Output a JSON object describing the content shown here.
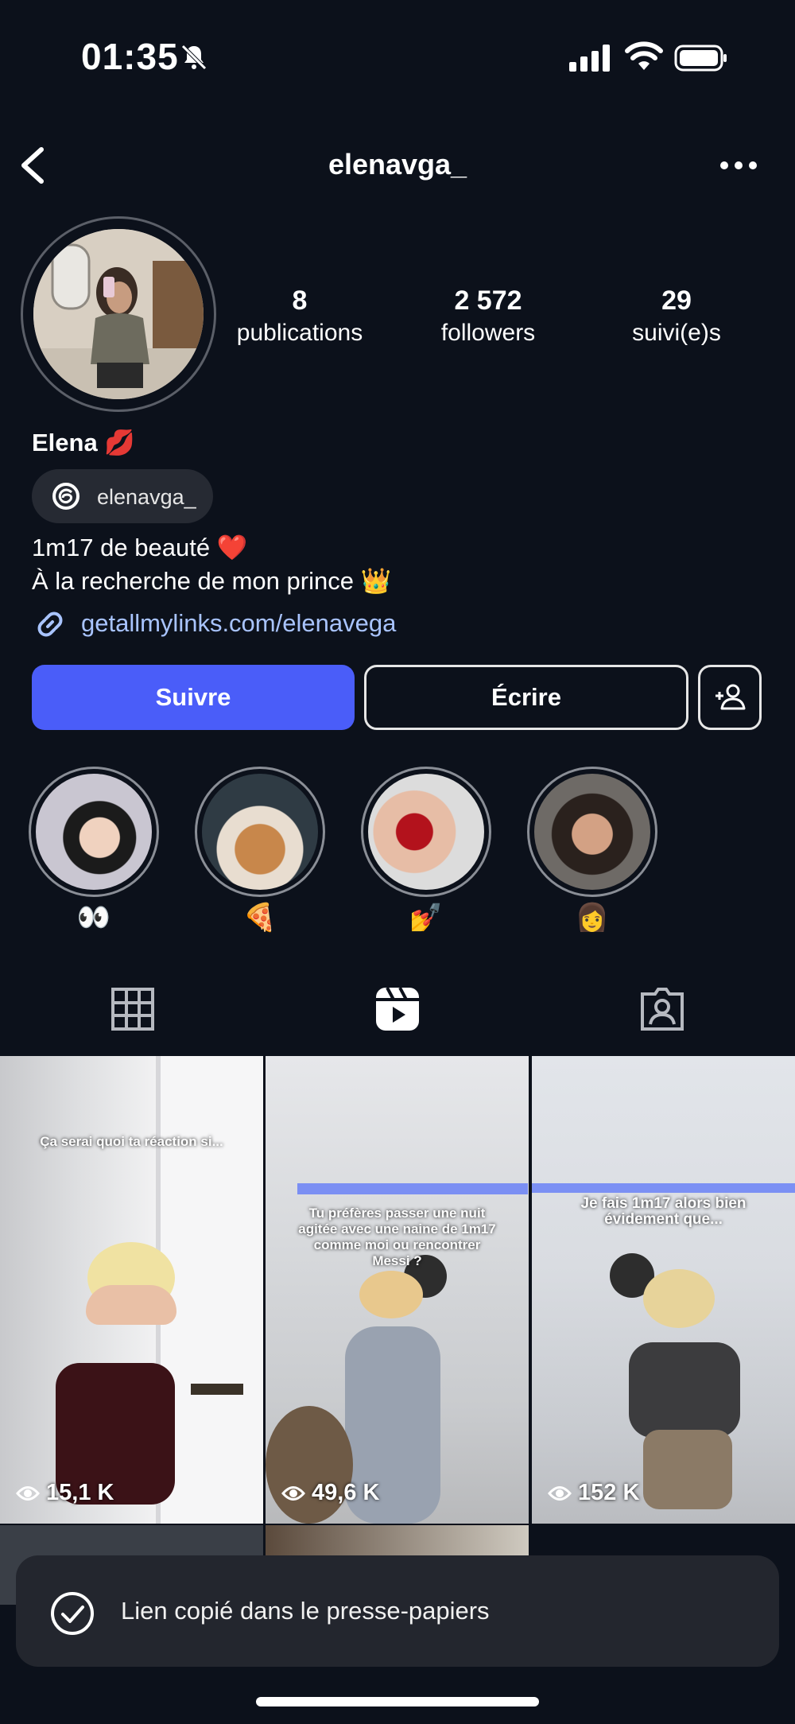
{
  "status_bar": {
    "time": "01:35"
  },
  "header": {
    "username": "elenavga_"
  },
  "profile": {
    "stats": [
      {
        "value": "8",
        "label": "publications"
      },
      {
        "value": "2 572",
        "label": "followers"
      },
      {
        "value": "29",
        "label": "suivi(e)s"
      }
    ],
    "name": "Elena 💋",
    "threads_handle": "elenavga_",
    "bio_line1": "1m17 de beauté ❤️",
    "bio_line2": "À la recherche de mon prince 👑",
    "link": "getallmylinks.com/elenavega"
  },
  "actions": {
    "follow": "Suivre",
    "message": "Écrire"
  },
  "highlights": [
    {
      "label": "👀"
    },
    {
      "label": "🍕"
    },
    {
      "label": "💅"
    },
    {
      "label": "👩"
    }
  ],
  "reels": [
    {
      "caption": "Ça serai quoi ta réaction si...",
      "views": "15,1 K"
    },
    {
      "caption": "Tu préfères passer une nuit agitée avec une naine de 1m17 comme moi ou rencontrer Messi ?",
      "views": "49,6 K"
    },
    {
      "caption": "Je fais 1m17 alors bien évidement que...",
      "views": "152 K"
    }
  ],
  "toast": {
    "message": "Lien copié dans le presse-papiers"
  },
  "colors": {
    "background": "#0c111b",
    "accent": "#4a5df9",
    "link": "#a9c4ff"
  }
}
